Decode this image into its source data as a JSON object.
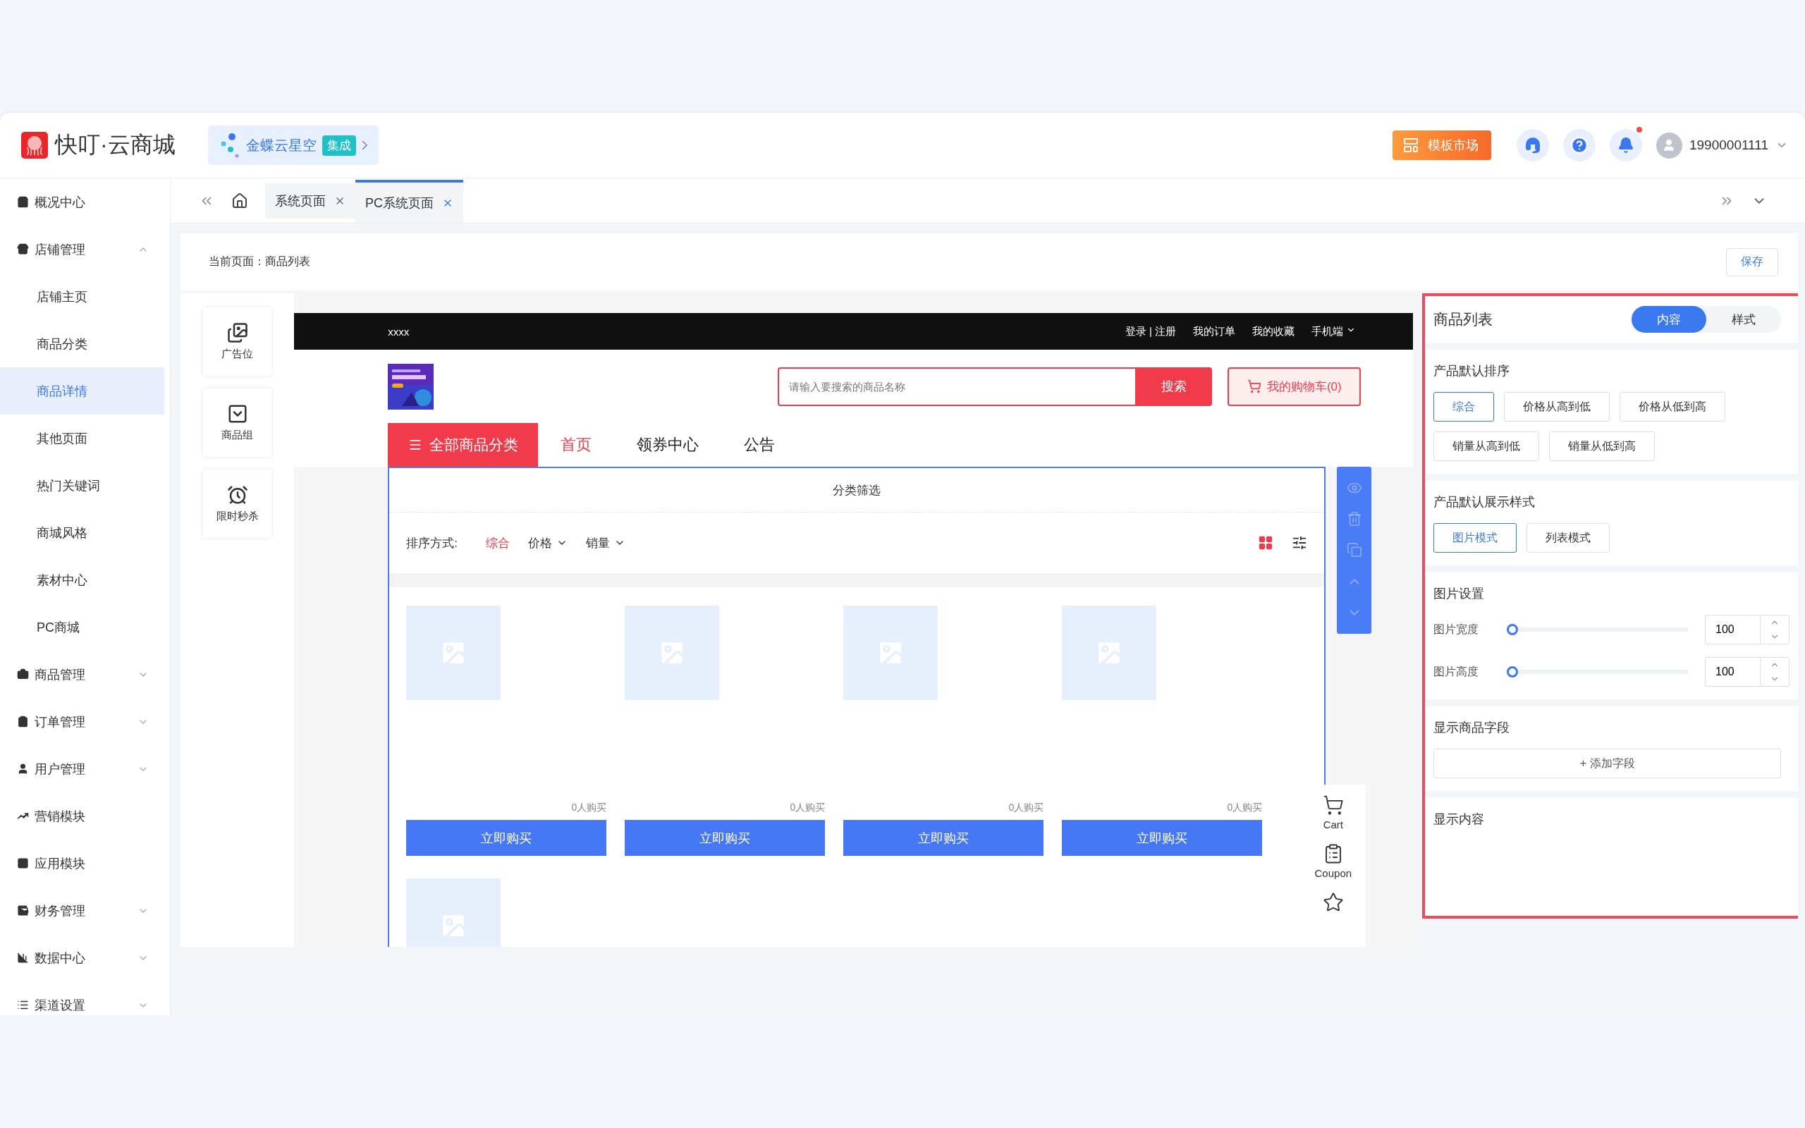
{
  "header": {
    "logo_text": "快叮·云商城",
    "integration": {
      "name": "金蝶云星空",
      "badge": "集成"
    },
    "template_button": "模板市场",
    "bell": {
      "unread": true
    },
    "user": "19900001111"
  },
  "sidebar": {
    "items": [
      {
        "label": "概况中心"
      },
      {
        "label": "店铺管理",
        "expanded": true,
        "children": [
          {
            "label": "店铺主页",
            "selected": false
          },
          {
            "label": "商品分类",
            "selected": false
          },
          {
            "label": "商品详情",
            "selected": true
          },
          {
            "label": "其他页面",
            "selected": false
          },
          {
            "label": "热门关键词",
            "selected": false
          },
          {
            "label": "商城风格",
            "selected": false
          },
          {
            "label": "素材中心",
            "selected": false
          },
          {
            "label": "PC商城",
            "selected": false
          }
        ]
      },
      {
        "label": "商品管理",
        "expanded": false
      },
      {
        "label": "订单管理",
        "expanded": false
      },
      {
        "label": "用户管理",
        "expanded": false
      },
      {
        "label": "营销模块"
      },
      {
        "label": "应用模块"
      },
      {
        "label": "财务管理",
        "expanded": false
      },
      {
        "label": "数据中心",
        "expanded": false
      },
      {
        "label": "渠道设置",
        "expanded": false
      }
    ]
  },
  "tabs": [
    {
      "label": "系统页面",
      "selected": false
    },
    {
      "label": "PC系统页面",
      "selected": true
    }
  ],
  "breadcrumb": "当前页面：商品列表",
  "save_button": "保存",
  "widgets": [
    {
      "label": "广告位"
    },
    {
      "label": "商品组"
    },
    {
      "label": "限时秒杀"
    }
  ],
  "preview": {
    "top_bar": {
      "site": "xxxx",
      "links": [
        "登录 | 注册",
        "我的订单",
        "我的收藏"
      ],
      "mobile": "手机端"
    },
    "search": {
      "placeholder": "请输入要搜索的商品名称",
      "button": "搜索"
    },
    "cart_button": "我的购物车(0)",
    "category_button": "全部商品分类",
    "nav": [
      {
        "label": "首页",
        "selected": true
      },
      {
        "label": "领券中心",
        "selected": false
      },
      {
        "label": "公告",
        "selected": false
      }
    ],
    "filter_title": "分类筛选",
    "sort_label": "排序方式:",
    "sort_options": [
      {
        "label": "综合",
        "selected": true,
        "dropdown": false
      },
      {
        "label": "价格",
        "selected": false,
        "dropdown": true
      },
      {
        "label": "销量",
        "selected": false,
        "dropdown": true
      }
    ],
    "view_modes": [
      {
        "selected": true
      },
      {
        "selected": false
      }
    ],
    "products": [
      {
        "kind": "placeholder",
        "sold": "0人购买",
        "button": "立即购买"
      },
      {
        "kind": "placeholder",
        "sold": "0人购买",
        "button": "立即购买"
      },
      {
        "kind": "placeholder",
        "sold": "0人购买",
        "button": "立即购买"
      },
      {
        "kind": "placeholder",
        "sold": "0人购买",
        "button": "立即购买"
      },
      {
        "kind": "placeholder"
      }
    ],
    "float_bar": {
      "cart": "Cart",
      "coupon": "Coupon"
    }
  },
  "settings": {
    "title": "商品列表",
    "tabs": [
      {
        "label": "内容",
        "selected": true
      },
      {
        "label": "样式",
        "selected": false
      }
    ],
    "sort": {
      "title": "产品默认排序",
      "options": [
        {
          "label": "综合",
          "selected": true
        },
        {
          "label": "价格从高到低",
          "selected": false
        },
        {
          "label": "价格从低到高",
          "selected": false
        },
        {
          "label": "销量从高到低",
          "selected": false
        },
        {
          "label": "销量从低到高",
          "selected": false
        }
      ]
    },
    "display": {
      "title": "产品默认展示样式",
      "options": [
        {
          "label": "图片模式",
          "selected": true
        },
        {
          "label": "列表模式",
          "selected": false
        }
      ]
    },
    "image": {
      "title": "图片设置",
      "rows": [
        {
          "label": "图片宽度",
          "level": 0,
          "value": "100"
        },
        {
          "label": "图片高度",
          "level": 0,
          "value": "100"
        }
      ]
    },
    "fields": {
      "title": "显示商品字段",
      "add_button": "+ 添加字段"
    },
    "content": {
      "title": "显示内容"
    }
  }
}
